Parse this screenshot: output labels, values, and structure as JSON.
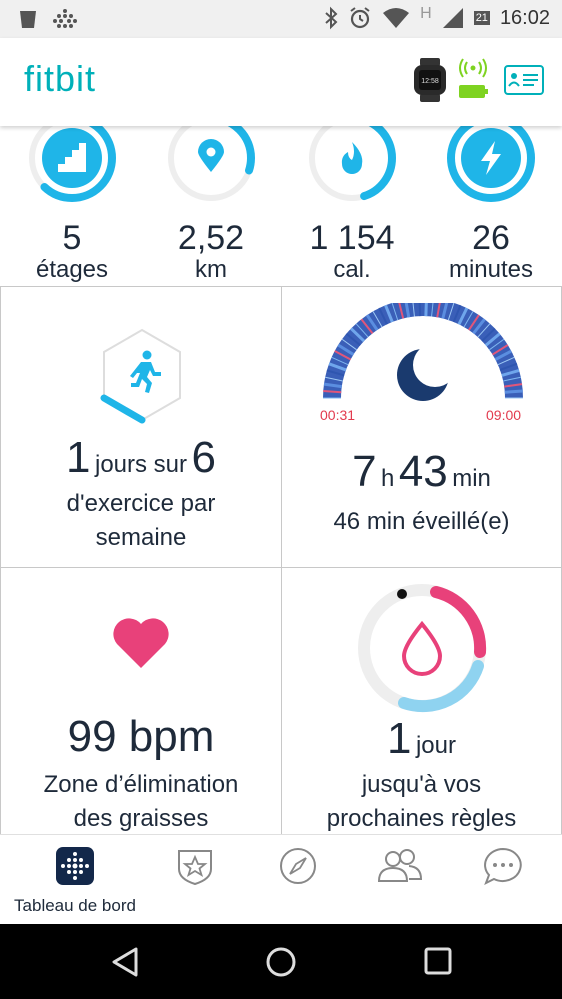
{
  "status_bar": {
    "time": "16:02",
    "network_label": "H",
    "signal_badge": "21"
  },
  "header": {
    "logo": "fitbit",
    "watch_time": "12:58"
  },
  "stats": [
    {
      "value": "5",
      "unit": "étages",
      "progress": 0.62
    },
    {
      "value": "2,52",
      "unit": "km",
      "progress": 0.3
    },
    {
      "value": "1 154",
      "unit": "cal.",
      "progress": 0.45
    },
    {
      "value": "26",
      "unit": "minutes",
      "progress": 1.0
    }
  ],
  "exercise": {
    "count": "1",
    "mid": "jours sur",
    "goal": "6",
    "line1": "d'exercice par",
    "line2": "semaine"
  },
  "sleep": {
    "start": "00:31",
    "end": "09:00",
    "hours": "7",
    "hours_unit": "h",
    "minutes": "43",
    "minutes_unit": "min",
    "awake": "46 min éveillé(e)"
  },
  "heart": {
    "value": "99 bpm",
    "line1": "Zone d’élimination",
    "line2": "des graisses"
  },
  "cycle": {
    "count": "1",
    "unit": "jour",
    "line1": "jusqu'à vos",
    "line2": "prochaines règles"
  },
  "bottom_nav": {
    "dashboard_label": "Tableau de bord"
  },
  "colors": {
    "teal": "#00b0b9",
    "ring_blue": "#1fb5e8",
    "pink": "#e8417a",
    "navy": "#1a3a6e",
    "sleep_red": "#e23a4e"
  }
}
